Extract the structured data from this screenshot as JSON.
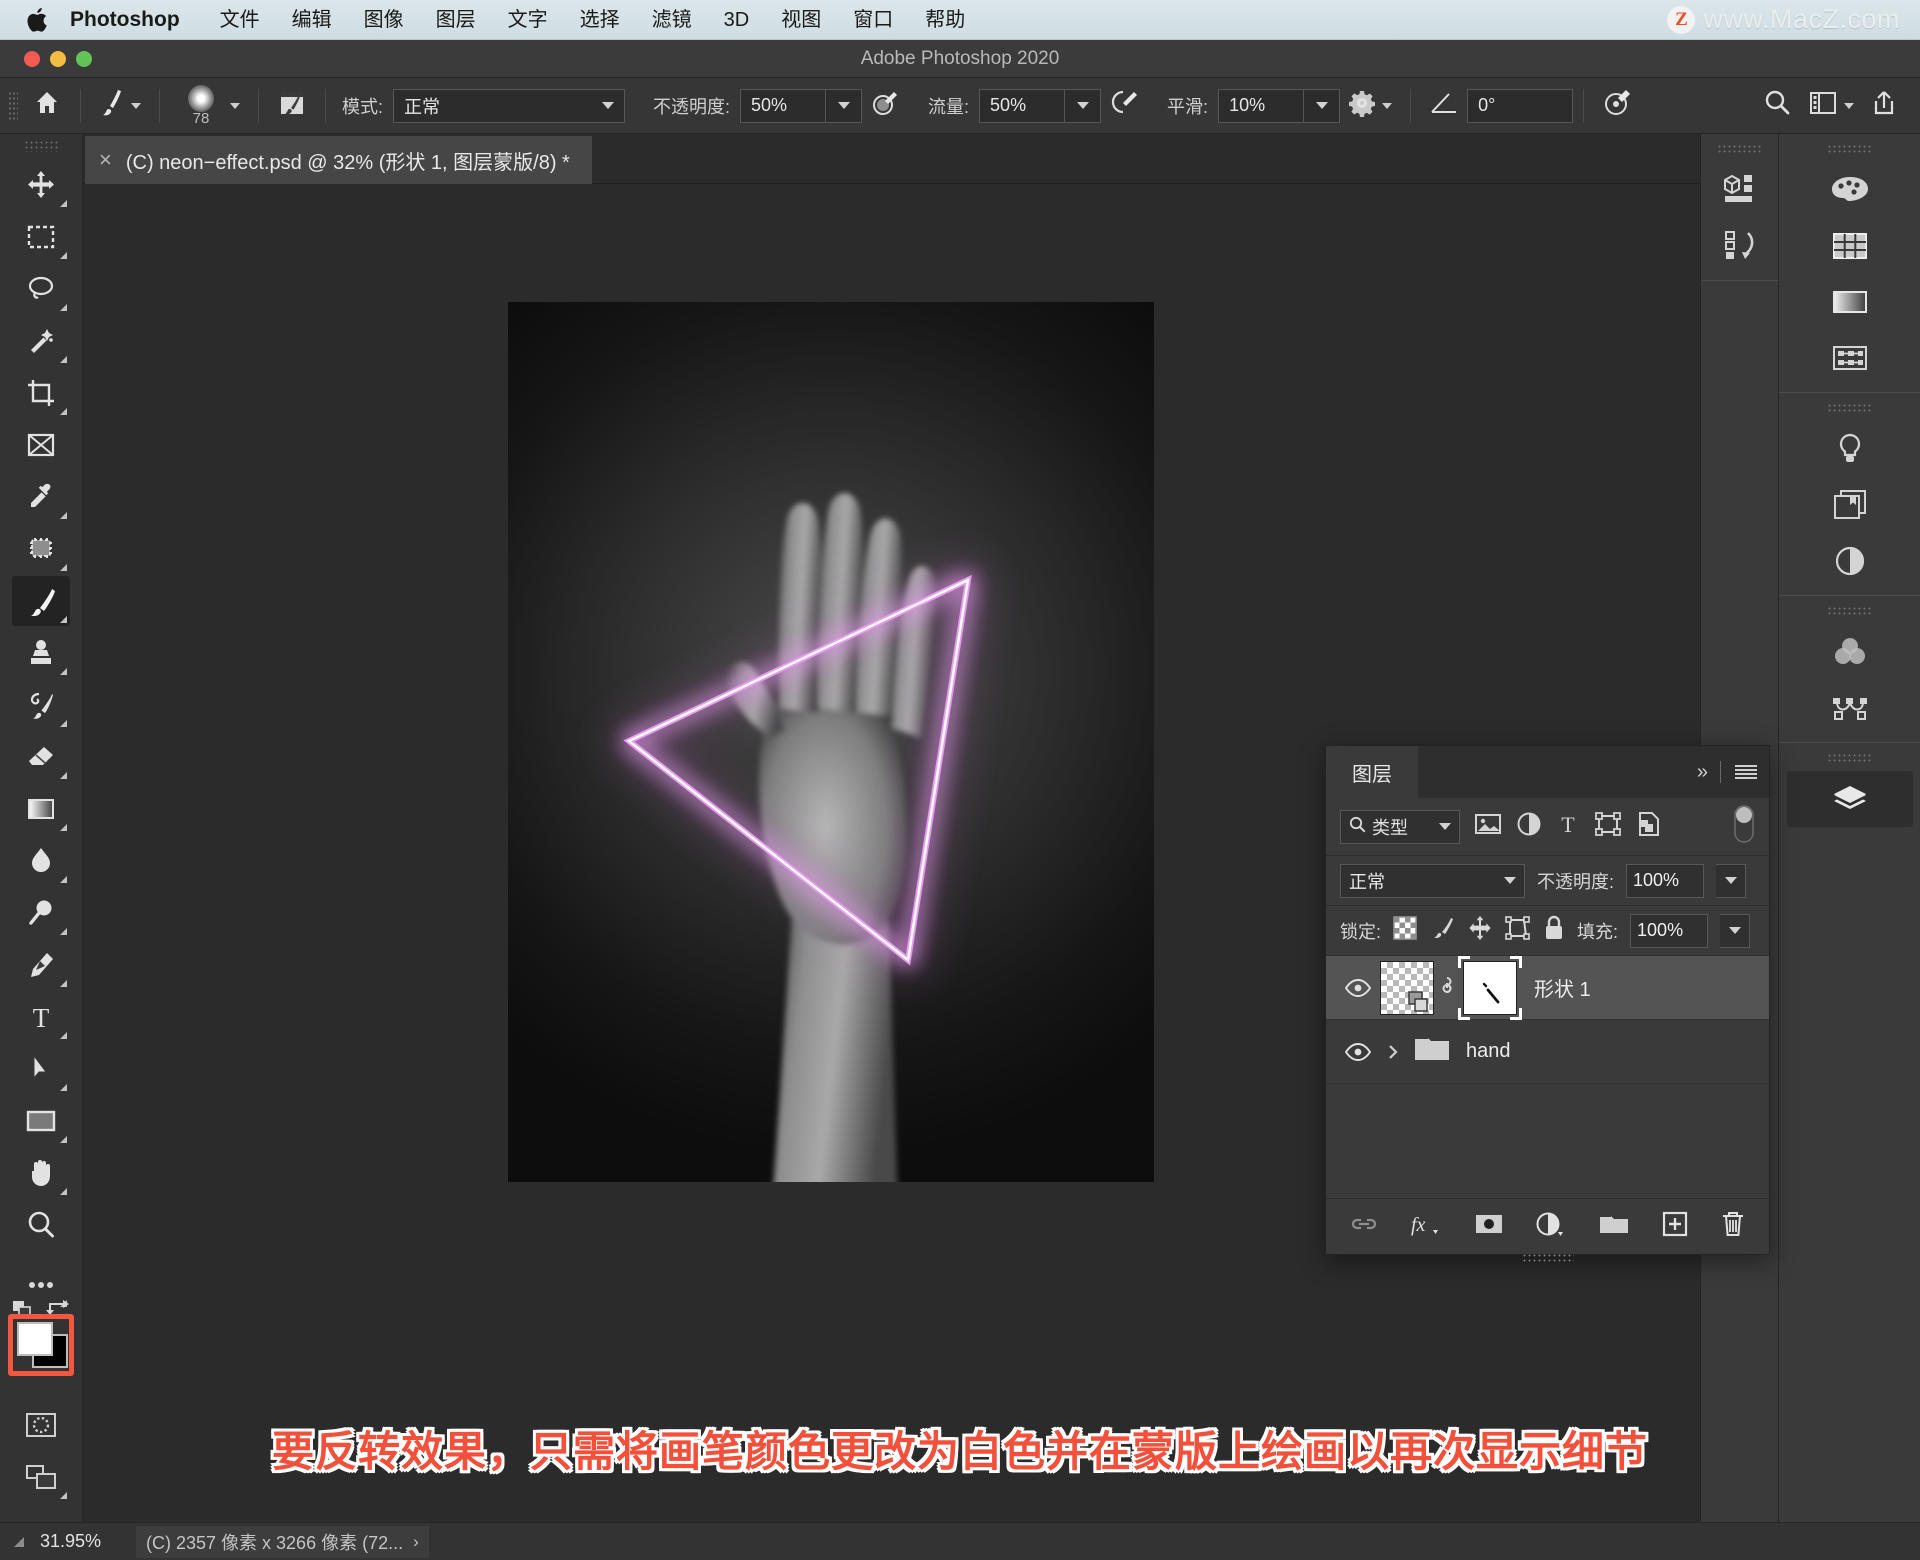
{
  "macbar": {
    "apple_icon": "apple-logo",
    "brand": "Photoshop",
    "menus": [
      "文件",
      "编辑",
      "图像",
      "图层",
      "文字",
      "选择",
      "滤镜",
      "3D",
      "视图",
      "窗口",
      "帮助"
    ],
    "watermark_badge": "Z",
    "watermark_text": "www.MacZ.com"
  },
  "titlebar": {
    "title": "Adobe Photoshop 2020"
  },
  "options": {
    "tool_preset_icon": "home-icon",
    "brush_preset_icon": "brush-preset-icon",
    "brush_size": "78",
    "brush_panel_icon": "brush-panel-icon",
    "mode_label": "模式:",
    "mode_value": "正常",
    "opacity_label": "不透明度:",
    "opacity_value": "50%",
    "pressure_opacity_icon": "pressure-opacity-icon",
    "flow_label": "流量:",
    "flow_value": "50%",
    "airbrush_icon": "airbrush-icon",
    "smoothing_label": "平滑:",
    "smoothing_value": "10%",
    "gear_icon": "gear-icon",
    "angle_icon": "angle-icon",
    "angle_value": "0°",
    "symmetry_icon": "symmetry-icon",
    "search_icon": "search-icon",
    "workspace_icon": "workspace-icon",
    "share_icon": "share-icon"
  },
  "tab": {
    "close": "×",
    "title": "(C) neon−effect.psd @ 32% (形状 1, 图层蒙版/8) *"
  },
  "toolbar": {
    "tools": [
      {
        "name": "move-tool",
        "icon": "move-icon",
        "has_flyout": true,
        "active": false
      },
      {
        "name": "rectangular-marquee-tool",
        "icon": "marquee-icon",
        "has_flyout": true,
        "active": false
      },
      {
        "name": "lasso-tool",
        "icon": "lasso-icon",
        "has_flyout": true,
        "active": false
      },
      {
        "name": "object-selection-tool",
        "icon": "magic-wand-icon",
        "has_flyout": true,
        "active": false
      },
      {
        "name": "crop-tool",
        "icon": "crop-icon",
        "has_flyout": true,
        "active": false
      },
      {
        "name": "frame-tool",
        "icon": "frame-icon",
        "has_flyout": false,
        "active": false
      },
      {
        "name": "eyedropper-tool",
        "icon": "eyedropper-icon",
        "has_flyout": true,
        "active": false
      },
      {
        "name": "spot-healing-brush-tool",
        "icon": "healing-brush-icon",
        "has_flyout": true,
        "active": false
      },
      {
        "name": "brush-tool",
        "icon": "brush-icon",
        "has_flyout": true,
        "active": true
      },
      {
        "name": "clone-stamp-tool",
        "icon": "clone-stamp-icon",
        "has_flyout": true,
        "active": false
      },
      {
        "name": "history-brush-tool",
        "icon": "history-brush-icon",
        "has_flyout": true,
        "active": false
      },
      {
        "name": "eraser-tool",
        "icon": "eraser-icon",
        "has_flyout": true,
        "active": false
      },
      {
        "name": "gradient-tool",
        "icon": "gradient-icon",
        "has_flyout": true,
        "active": false
      },
      {
        "name": "blur-tool",
        "icon": "blur-drop-icon",
        "has_flyout": true,
        "active": false
      },
      {
        "name": "dodge-tool",
        "icon": "dodge-icon",
        "has_flyout": true,
        "active": false
      },
      {
        "name": "pen-tool",
        "icon": "pen-icon",
        "has_flyout": true,
        "active": false
      },
      {
        "name": "type-tool",
        "icon": "type-icon",
        "has_flyout": true,
        "active": false
      },
      {
        "name": "path-selection-tool",
        "icon": "path-arrow-icon",
        "has_flyout": true,
        "active": false
      },
      {
        "name": "rectangle-tool",
        "icon": "rectangle-icon",
        "has_flyout": true,
        "active": false
      },
      {
        "name": "hand-tool",
        "icon": "hand-icon",
        "has_flyout": true,
        "active": false
      },
      {
        "name": "zoom-tool",
        "icon": "zoom-icon",
        "has_flyout": false,
        "active": false
      },
      {
        "name": "edit-toolbar",
        "icon": "ellipsis-icon",
        "has_flyout": true,
        "active": false
      }
    ],
    "foreground_color": "#ffffff",
    "background_color": "#000000",
    "selection_highlight_color": "#f2573f",
    "default_colors_icon": "default-colors-icon",
    "swap_colors_icon": "swap-colors-icon",
    "quick_mask_icon": "quick-mask-icon",
    "screen_mode_icon": "screen-mode-icon"
  },
  "canvas": {
    "document_background": "#0d0d0d",
    "neon_color": "#e89ef0",
    "artwork_description": "黑白手掌照片与霓虹三角形"
  },
  "right_dock": {
    "column_a": [
      {
        "name": "3d-panel-icon",
        "icon": "3d-icon"
      },
      {
        "name": "history-panel-icon",
        "icon": "history-icon"
      }
    ],
    "column_b_group1": [
      {
        "name": "color-panel-icon",
        "icon": "palette-icon"
      },
      {
        "name": "swatches-panel-icon",
        "icon": "swatches-grid-icon"
      },
      {
        "name": "gradients-panel-icon",
        "icon": "gradient-bar-icon"
      },
      {
        "name": "patterns-panel-icon",
        "icon": "patterns-icon"
      }
    ],
    "column_b_group2": [
      {
        "name": "learn-panel-icon",
        "icon": "lightbulb-icon"
      },
      {
        "name": "libraries-panel-icon",
        "icon": "libraries-icon"
      },
      {
        "name": "adjustments-panel-icon",
        "icon": "adjustments-half-circle-icon"
      }
    ],
    "column_b_group3": [
      {
        "name": "channels-panel-icon",
        "icon": "venn-circles-icon"
      },
      {
        "name": "paths-panel-icon",
        "icon": "paths-bezier-icon"
      }
    ],
    "column_b_group4": [
      {
        "name": "layers-panel-icon",
        "icon": "layers-stack-icon",
        "selected": true
      }
    ]
  },
  "layers_panel": {
    "tab_label": "图层",
    "collapse_icon": "double-chevron-icon",
    "menu_icon": "panel-menu-icon",
    "filter": {
      "search_icon": "search-icon",
      "kind_label": "类型",
      "filter_icons": [
        {
          "name": "filter-pixel-icon",
          "icon": "image-icon"
        },
        {
          "name": "filter-adjustment-icon",
          "icon": "half-circle-icon"
        },
        {
          "name": "filter-type-icon",
          "icon": "type-t-icon"
        },
        {
          "name": "filter-shape-icon",
          "icon": "shape-icon"
        },
        {
          "name": "filter-smart-object-icon",
          "icon": "smart-object-icon"
        }
      ],
      "toggle_name": "filter-toggle-switch"
    },
    "blend_mode": "正常",
    "opacity_label": "不透明度:",
    "opacity_value": "100%",
    "lock_label": "锁定:",
    "lock_icons": [
      {
        "name": "lock-transparent-pixels-icon",
        "icon": "checker-icon"
      },
      {
        "name": "lock-image-pixels-icon",
        "icon": "brush-icon"
      },
      {
        "name": "lock-position-icon",
        "icon": "move-arrows-icon"
      },
      {
        "name": "lock-artboard-nesting-icon",
        "icon": "artboard-icon"
      },
      {
        "name": "lock-all-icon",
        "icon": "padlock-icon"
      }
    ],
    "fill_label": "填充:",
    "fill_value": "100%",
    "layers": [
      {
        "name": "形状 1",
        "visible": true,
        "selected": true,
        "has_mask": true,
        "type": "shape",
        "linked": true
      },
      {
        "name": "hand",
        "visible": true,
        "selected": false,
        "type": "group",
        "expanded": false
      }
    ],
    "bottom_buttons": [
      {
        "name": "link-layers-button",
        "icon": "link-icon"
      },
      {
        "name": "layer-style-button",
        "icon": "fx-icon"
      },
      {
        "name": "add-layer-mask-button",
        "icon": "mask-icon"
      },
      {
        "name": "new-adjustment-layer-button",
        "icon": "half-circle-icon"
      },
      {
        "name": "new-group-button",
        "icon": "folder-icon"
      },
      {
        "name": "new-layer-button",
        "icon": "plus-square-icon"
      },
      {
        "name": "delete-layer-button",
        "icon": "trash-icon"
      }
    ]
  },
  "annotation": {
    "text": "要反转效果，只需将画笔颜色更改为白色并在蒙版上绘画以再次显示细节",
    "color": "#f2503a",
    "outline_color": "#ffffff"
  },
  "status_bar": {
    "zoom": "31.95%",
    "doc_info": "(C) 2357 像素 x 3266 像素 (72...",
    "chevron": "›"
  }
}
